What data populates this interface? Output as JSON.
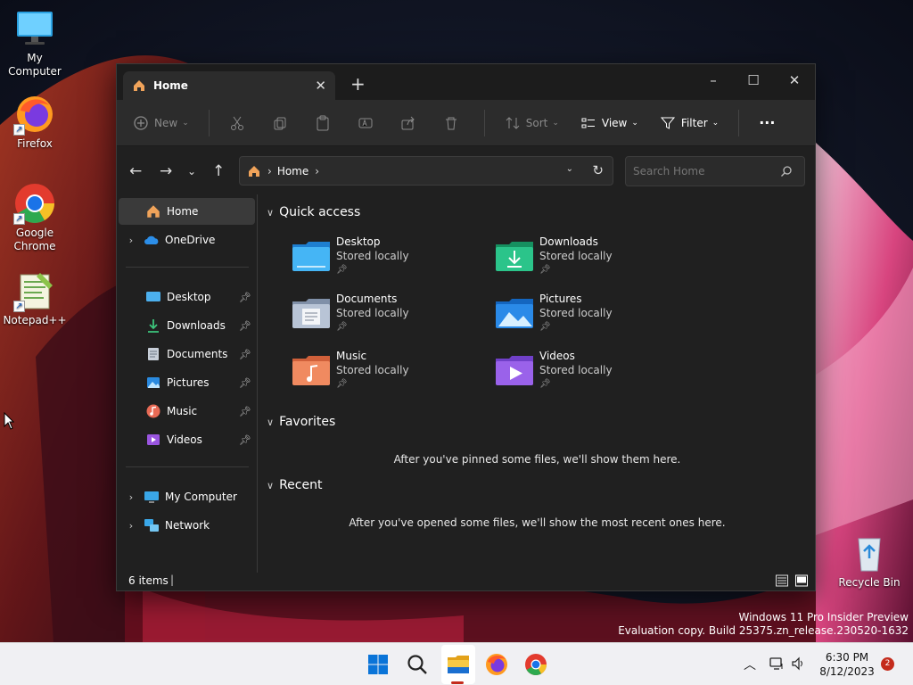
{
  "desktop": {
    "icons": [
      {
        "label": "My Computer"
      },
      {
        "label": "Firefox"
      },
      {
        "label": "Google Chrome"
      },
      {
        "label": "Notepad++"
      },
      {
        "label": "Recycle Bin"
      }
    ]
  },
  "window": {
    "tab_title": "Home",
    "new_tab": "+",
    "controls": {
      "minimize": "–",
      "maximize": "☐",
      "close": "✕"
    }
  },
  "commandbar": {
    "new_label": "New",
    "sort_label": "Sort",
    "view_label": "View",
    "filter_label": "Filter",
    "more": "···"
  },
  "address": {
    "crumb": "Home",
    "search_placeholder": "Search Home"
  },
  "navpane": {
    "items": [
      {
        "label": "Home"
      },
      {
        "label": "OneDrive"
      },
      {
        "label": "Desktop"
      },
      {
        "label": "Downloads"
      },
      {
        "label": "Documents"
      },
      {
        "label": "Pictures"
      },
      {
        "label": "Music"
      },
      {
        "label": "Videos"
      },
      {
        "label": "My Computer"
      },
      {
        "label": "Network"
      }
    ]
  },
  "content": {
    "quick_access_title": "Quick access",
    "favorites_title": "Favorites",
    "recent_title": "Recent",
    "quick_access": [
      {
        "name": "Desktop",
        "sub": "Stored locally"
      },
      {
        "name": "Downloads",
        "sub": "Stored locally"
      },
      {
        "name": "Documents",
        "sub": "Stored locally"
      },
      {
        "name": "Pictures",
        "sub": "Stored locally"
      },
      {
        "name": "Music",
        "sub": "Stored locally"
      },
      {
        "name": "Videos",
        "sub": "Stored locally"
      }
    ],
    "favorites_empty": "After you've pinned some files, we'll show them here.",
    "recent_empty": "After you've opened some files, we'll show the most recent ones here."
  },
  "status": {
    "items": "6 items"
  },
  "watermark": {
    "line1": "Windows 11 Pro Insider Preview",
    "line2": "Evaluation copy. Build 25375.zn_release.230520-1632"
  },
  "taskbar": {
    "time": "6:30 PM",
    "date": "8/12/2023",
    "notifications": "2"
  },
  "colors": {
    "accent": "#0078d4",
    "folder": "#e8a93a",
    "badge": "#c42b1c"
  }
}
